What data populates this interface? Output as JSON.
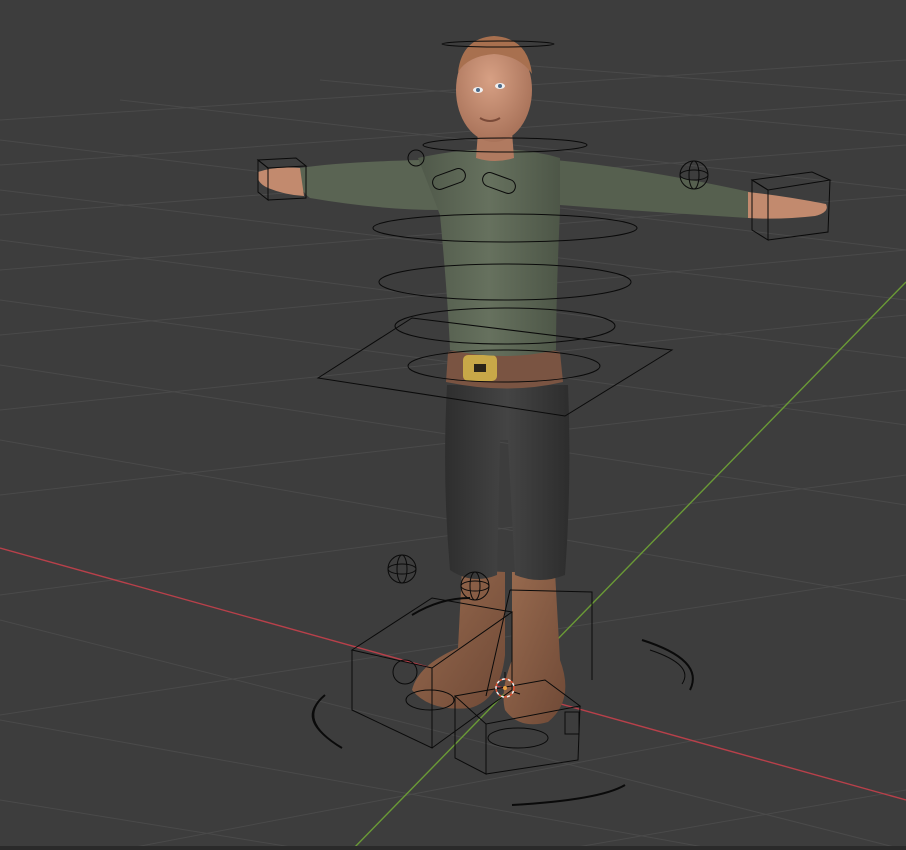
{
  "app": {
    "view": "3d-viewport",
    "mode": "object-pose",
    "shading": "solid"
  },
  "scene": {
    "object": "character-armature-rig",
    "visible_elements": [
      "grid-floor",
      "x-axis-line",
      "y-axis-line",
      "character-mesh",
      "rig-controls",
      "3d-cursor"
    ]
  },
  "colors": {
    "background": "#3d3d3d",
    "grid": "#4a4a4a",
    "x_axis": "#b8404a",
    "y_axis": "#6a9a36",
    "shirt": "#5c6655",
    "pants": "#3a3a3a",
    "skin": "#c28a6e",
    "boots": "#8a5e45",
    "belt_buckle": "#c8a848",
    "rig_wire": "#0a0a0a",
    "cursor": "#e05030"
  },
  "icons": {
    "cursor": "3d-cursor-icon",
    "empties": "sphere-empty-icon"
  }
}
